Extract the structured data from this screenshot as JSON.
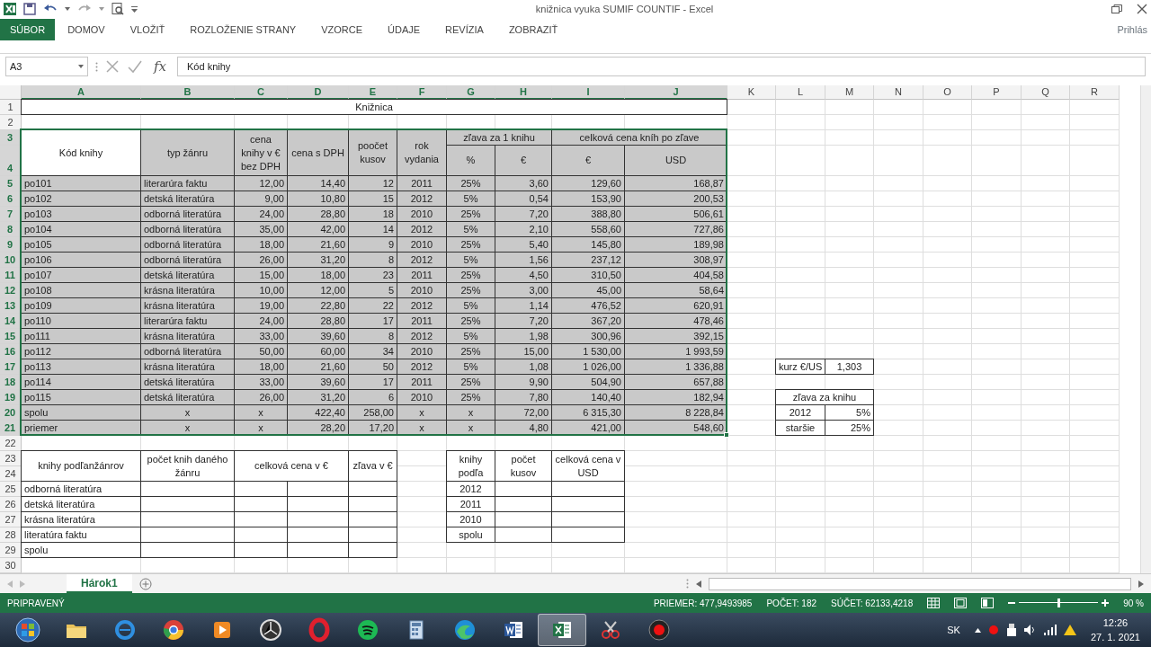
{
  "window": {
    "title": "knižnica vyuka SUMIF COUNTIF - Excel"
  },
  "ribbon": {
    "tabs": [
      {
        "label": "SÚBOR",
        "kind": "file"
      },
      {
        "label": "DOMOV",
        "kind": "tab"
      },
      {
        "label": "VLOŽIŤ",
        "kind": "tab"
      },
      {
        "label": "ROZLOŽENIE STRANY",
        "kind": "tab"
      },
      {
        "label": "VZORCE",
        "kind": "tab"
      },
      {
        "label": "ÚDAJE",
        "kind": "tab"
      },
      {
        "label": "REVÍZIA",
        "kind": "tab"
      },
      {
        "label": "ZOBRAZIŤ",
        "kind": "tab"
      }
    ],
    "account": "Prihlás"
  },
  "formula_bar": {
    "name_box": "A3",
    "function_label": "fx",
    "value": "Kód knihy"
  },
  "column_headers": [
    {
      "label": "A",
      "selected": true
    },
    {
      "label": "B",
      "selected": true
    },
    {
      "label": "C",
      "selected": true
    },
    {
      "label": "D",
      "selected": true
    },
    {
      "label": "E",
      "selected": true
    },
    {
      "label": "F",
      "selected": true
    },
    {
      "label": "G",
      "selected": true
    },
    {
      "label": "H",
      "selected": true
    },
    {
      "label": "I",
      "selected": true
    },
    {
      "label": "J",
      "selected": true
    },
    {
      "label": "K",
      "selected": false
    },
    {
      "label": "L",
      "selected": false
    },
    {
      "label": "M",
      "selected": false
    },
    {
      "label": "N",
      "selected": false
    },
    {
      "label": "O",
      "selected": false
    },
    {
      "label": "P",
      "selected": false
    },
    {
      "label": "Q",
      "selected": false
    },
    {
      "label": "R",
      "selected": false
    }
  ],
  "row_headers": [
    {
      "label": "1",
      "selected": false
    },
    {
      "label": "2",
      "selected": false
    },
    {
      "label": "3",
      "selected": true
    },
    {
      "label": "4",
      "selected": true
    },
    {
      "label": "5",
      "selected": true
    },
    {
      "label": "6",
      "selected": true
    },
    {
      "label": "7",
      "selected": true
    },
    {
      "label": "8",
      "selected": true
    },
    {
      "label": "9",
      "selected": true
    },
    {
      "label": "10",
      "selected": true
    },
    {
      "label": "11",
      "selected": true
    },
    {
      "label": "12",
      "selected": true
    },
    {
      "label": "13",
      "selected": true
    },
    {
      "label": "14",
      "selected": true
    },
    {
      "label": "15",
      "selected": true
    },
    {
      "label": "16",
      "selected": true
    },
    {
      "label": "17",
      "selected": true
    },
    {
      "label": "18",
      "selected": true
    },
    {
      "label": "19",
      "selected": true
    },
    {
      "label": "20",
      "selected": true
    },
    {
      "label": "21",
      "selected": true
    },
    {
      "label": "22",
      "selected": false
    },
    {
      "label": "23",
      "selected": false
    },
    {
      "label": "24",
      "selected": false
    },
    {
      "label": "25",
      "selected": false
    },
    {
      "label": "26",
      "selected": false
    },
    {
      "label": "27",
      "selected": false
    },
    {
      "label": "28",
      "selected": false
    },
    {
      "label": "29",
      "selected": false
    },
    {
      "label": "30",
      "selected": false
    }
  ],
  "main_table": {
    "title": "Knižnica",
    "selected": true,
    "header": [
      {
        "label": "Kód knihy",
        "active": true
      },
      {
        "label": "typ žánru",
        "active": false
      },
      {
        "label": "cena knihy v € bez DPH",
        "active": false
      },
      {
        "label": "cena s DPH",
        "active": false
      },
      {
        "label": "poočet kusov",
        "active": false
      },
      {
        "label": "rok vydania",
        "active": false
      },
      {
        "label": "zľava za 1 knihu",
        "active": false,
        "sub": [
          "%",
          "€"
        ]
      },
      {
        "label": "celková cena kníh po zľave",
        "active": false,
        "sub": [
          "€",
          "USD"
        ]
      }
    ],
    "rows": [
      {
        "kind": "item",
        "cells": [
          "po101",
          "literarúra faktu",
          "12,00",
          "14,40",
          "12",
          "2011",
          "25%",
          "3,60",
          "129,60",
          "168,87"
        ]
      },
      {
        "kind": "item",
        "cells": [
          "po102",
          "detská literatúra",
          "9,00",
          "10,80",
          "15",
          "2012",
          "5%",
          "0,54",
          "153,90",
          "200,53"
        ]
      },
      {
        "kind": "item",
        "cells": [
          "po103",
          "odborná literatúra",
          "24,00",
          "28,80",
          "18",
          "2010",
          "25%",
          "7,20",
          "388,80",
          "506,61"
        ]
      },
      {
        "kind": "item",
        "cells": [
          "po104",
          "odborná literatúra",
          "35,00",
          "42,00",
          "14",
          "2012",
          "5%",
          "2,10",
          "558,60",
          "727,86"
        ]
      },
      {
        "kind": "item",
        "cells": [
          "po105",
          "odborná literatúra",
          "18,00",
          "21,60",
          "9",
          "2010",
          "25%",
          "5,40",
          "145,80",
          "189,98"
        ]
      },
      {
        "kind": "item",
        "cells": [
          "po106",
          "odborná literatúra",
          "26,00",
          "31,20",
          "8",
          "2012",
          "5%",
          "1,56",
          "237,12",
          "308,97"
        ]
      },
      {
        "kind": "item",
        "cells": [
          "po107",
          "detská literatúra",
          "15,00",
          "18,00",
          "23",
          "2011",
          "25%",
          "4,50",
          "310,50",
          "404,58"
        ]
      },
      {
        "kind": "item",
        "cells": [
          "po108",
          "krásna literatúra",
          "10,00",
          "12,00",
          "5",
          "2010",
          "25%",
          "3,00",
          "45,00",
          "58,64"
        ]
      },
      {
        "kind": "item",
        "cells": [
          "po109",
          "krásna literatúra",
          "19,00",
          "22,80",
          "22",
          "2012",
          "5%",
          "1,14",
          "476,52",
          "620,91"
        ]
      },
      {
        "kind": "item",
        "cells": [
          "po110",
          "literarúra faktu",
          "24,00",
          "28,80",
          "17",
          "2011",
          "25%",
          "7,20",
          "367,20",
          "478,46"
        ]
      },
      {
        "kind": "item",
        "cells": [
          "po111",
          "krásna literatúra",
          "33,00",
          "39,60",
          "8",
          "2012",
          "5%",
          "1,98",
          "300,96",
          "392,15"
        ]
      },
      {
        "kind": "item",
        "cells": [
          "po112",
          "odborná literatúra",
          "50,00",
          "60,00",
          "34",
          "2010",
          "25%",
          "15,00",
          "1 530,00",
          "1 993,59"
        ]
      },
      {
        "kind": "item",
        "cells": [
          "po113",
          "krásna literatúra",
          "18,00",
          "21,60",
          "50",
          "2012",
          "5%",
          "1,08",
          "1 026,00",
          "1 336,88"
        ]
      },
      {
        "kind": "item",
        "cells": [
          "po114",
          "detská literatúra",
          "33,00",
          "39,60",
          "17",
          "2011",
          "25%",
          "9,90",
          "504,90",
          "657,88"
        ]
      },
      {
        "kind": "item",
        "cells": [
          "po115",
          "detská literatúra",
          "26,00",
          "31,20",
          "6",
          "2010",
          "25%",
          "7,80",
          "140,40",
          "182,94"
        ]
      },
      {
        "kind": "total",
        "cells": [
          "spolu",
          "x",
          "x",
          "422,40",
          "258,00",
          "x",
          "x",
          "72,00",
          "6 315,30",
          "8 228,84"
        ]
      },
      {
        "kind": "total",
        "cells": [
          "priemer",
          "x",
          "x",
          "28,20",
          "17,20",
          "x",
          "x",
          "4,80",
          "421,00",
          "548,60"
        ]
      }
    ]
  },
  "genre_table": {
    "headers": [
      {
        "label": "knihy podľanžánrov",
        "kind": "single"
      },
      {
        "label": "počet knih daného žánru",
        "kind": "single"
      },
      {
        "label": "celková cena v €",
        "kind": "split"
      },
      {
        "label": "zľava v €",
        "kind": "single"
      }
    ],
    "rows": [
      "odborná literatúra",
      "detská literatúra",
      "krásna literatúra",
      "literatúra faktu",
      "spolu"
    ]
  },
  "year_table": {
    "headers": [
      {
        "label": "knihy podľa",
        "kind": "single"
      },
      {
        "label": "počet kusov",
        "kind": "single"
      },
      {
        "label": "celková cena v USD",
        "kind": "single"
      }
    ],
    "rows": [
      "2012",
      "2011",
      "2010",
      "spolu"
    ]
  },
  "exchange_rate": {
    "label": "kurz €/US",
    "value": "1,303"
  },
  "discount_table": {
    "title": "zľava za knihu",
    "rows": [
      {
        "label": "2012",
        "value": "5%"
      },
      {
        "label": "staršie",
        "value": "25%"
      }
    ]
  },
  "sheet_tabs": [
    {
      "label": "Hárok1",
      "selected": true
    }
  ],
  "status_bar": {
    "mode": "PRIPRAVENÝ",
    "stats": [
      "PRIEMER: 477,9493985",
      "POČET: 182",
      "SÚČET: 62133,4218"
    ],
    "zoom": {
      "level": 0.5,
      "reading": "90 %"
    }
  },
  "taskbar": {
    "apps": [
      {
        "kind": "start",
        "selected": false
      },
      {
        "kind": "folder",
        "selected": false
      },
      {
        "kind": "ie",
        "selected": false
      },
      {
        "kind": "chrome",
        "selected": false
      },
      {
        "kind": "media",
        "selected": false
      },
      {
        "kind": "clock",
        "selected": false
      },
      {
        "kind": "opera",
        "selected": false
      },
      {
        "kind": "spotify",
        "selected": false
      },
      {
        "kind": "calculator",
        "selected": false
      },
      {
        "kind": "edge",
        "selected": false
      },
      {
        "kind": "word",
        "selected": false
      },
      {
        "kind": "excel",
        "selected": true
      },
      {
        "kind": "scissors",
        "selected": false
      },
      {
        "kind": "recorder",
        "selected": false
      }
    ],
    "language": "SK",
    "time": "12:26",
    "date": "27. 1. 2021"
  }
}
